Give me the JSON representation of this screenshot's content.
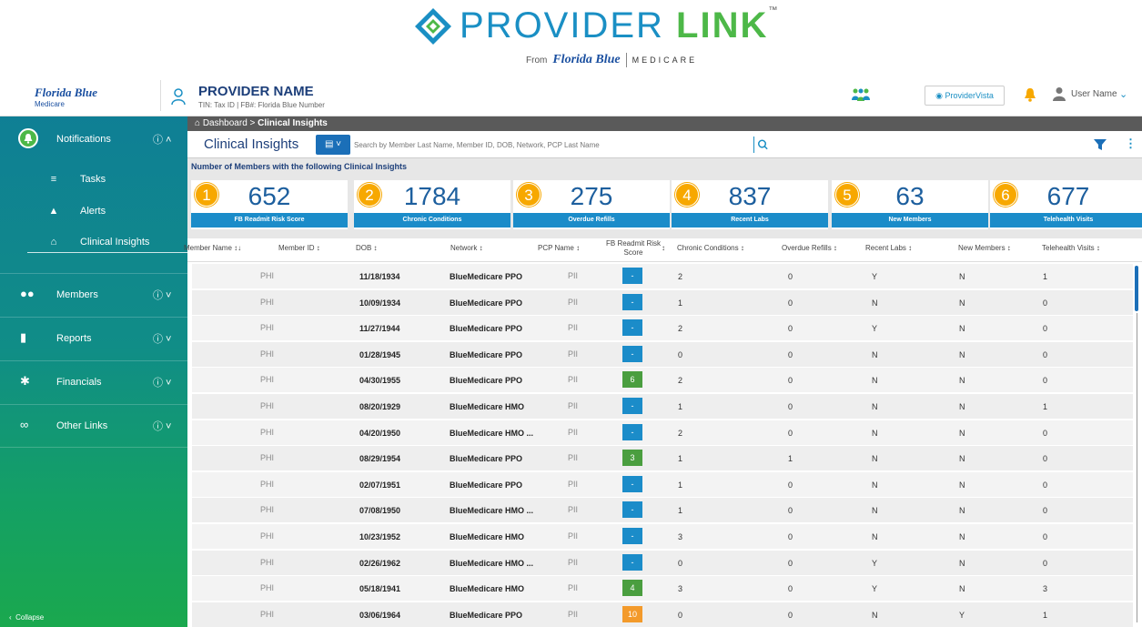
{
  "brand": {
    "title_part1": "PROVIDER ",
    "title_part2": "LINK",
    "trademark": "™",
    "sub_from": "From",
    "sub_company": "Florida Blue",
    "sub_medicare": "MEDICARE"
  },
  "header": {
    "company": "Florida Blue",
    "company_sub": "Medicare",
    "provider_name": "PROVIDER NAME",
    "tin_line": "TIN: Tax ID  |  FB#: Florida Blue Number",
    "provider_vista": "ProviderVista",
    "user_name": "User Name"
  },
  "sidebar": {
    "notifications": "Notifications",
    "sub_items": [
      "Tasks",
      "Alerts",
      "Clinical Insights"
    ],
    "sections": [
      "Members",
      "Reports",
      "Financials",
      "Other Links"
    ],
    "collapse": "Collapse"
  },
  "breadcrumb": {
    "home": "Dashboard",
    "sep": " > ",
    "current": "Clinical Insights"
  },
  "toolbar": {
    "title": "Clinical Insights",
    "search_placeholder": "Search by Member Last Name, Member ID, DOB, Network, PCP Last Name"
  },
  "cards": {
    "title": "Number of Members with the following Clinical Insights",
    "items": [
      {
        "badge": "1",
        "value": "652",
        "label": "FB Readmit Risk Score"
      },
      {
        "badge": "2",
        "value": "1784",
        "label": "Chronic Conditions"
      },
      {
        "badge": "3",
        "value": "275",
        "label": "Overdue Refills"
      },
      {
        "badge": "4",
        "value": "837",
        "label": "Recent Labs"
      },
      {
        "badge": "5",
        "value": "63",
        "label": "New Members"
      },
      {
        "badge": "6",
        "value": "677",
        "label": "Telehealth Visits"
      }
    ]
  },
  "table": {
    "headers": {
      "member_name": "Member Name ↕↓",
      "member_id": "Member ID ↕",
      "dob": "DOB ↕",
      "network": "Network ↕",
      "pcp": "PCP Name ↕",
      "risk": "FB Readmit Risk Score",
      "risk_sort": "↕",
      "chronic": "Chronic Conditions ↕",
      "refills": "Overdue Refills ↕",
      "labs": "Recent Labs ↕",
      "new": "New Members ↕",
      "tele": "Telehealth Visits ↕"
    },
    "rows": [
      {
        "member": "PHI",
        "dob": "11/18/1934",
        "network": "BlueMedicare PPO",
        "pcp": "PII",
        "score": "-",
        "score_color": "#1b8cc9",
        "chronic": "2",
        "refills": "0",
        "labs": "Y",
        "new": "N",
        "tele": "1"
      },
      {
        "member": "PHI",
        "dob": "10/09/1934",
        "network": "BlueMedicare PPO",
        "pcp": "PII",
        "score": "-",
        "score_color": "#1b8cc9",
        "chronic": "1",
        "refills": "0",
        "labs": "N",
        "new": "N",
        "tele": "0"
      },
      {
        "member": "PHI",
        "dob": "11/27/1944",
        "network": "BlueMedicare PPO",
        "pcp": "PII",
        "score": "-",
        "score_color": "#1b8cc9",
        "chronic": "2",
        "refills": "0",
        "labs": "Y",
        "new": "N",
        "tele": "0"
      },
      {
        "member": "PHI",
        "dob": "01/28/1945",
        "network": "BlueMedicare PPO",
        "pcp": "PII",
        "score": "-",
        "score_color": "#1b8cc9",
        "chronic": "0",
        "refills": "0",
        "labs": "N",
        "new": "N",
        "tele": "0"
      },
      {
        "member": "PHI",
        "dob": "04/30/1955",
        "network": "BlueMedicare PPO",
        "pcp": "PII",
        "score": "6",
        "score_color": "#4a9e3f",
        "chronic": "2",
        "refills": "0",
        "labs": "N",
        "new": "N",
        "tele": "0"
      },
      {
        "member": "PHI",
        "dob": "08/20/1929",
        "network": "BlueMedicare HMO",
        "pcp": "PII",
        "score": "-",
        "score_color": "#1b8cc9",
        "chronic": "1",
        "refills": "0",
        "labs": "N",
        "new": "N",
        "tele": "1"
      },
      {
        "member": "PHI",
        "dob": "04/20/1950",
        "network": "BlueMedicare HMO ...",
        "pcp": "PII",
        "score": "-",
        "score_color": "#1b8cc9",
        "chronic": "2",
        "refills": "0",
        "labs": "N",
        "new": "N",
        "tele": "0"
      },
      {
        "member": "PHI",
        "dob": "08/29/1954",
        "network": "BlueMedicare PPO",
        "pcp": "PII",
        "score": "3",
        "score_color": "#4a9e3f",
        "chronic": "1",
        "refills": "1",
        "labs": "N",
        "new": "N",
        "tele": "0"
      },
      {
        "member": "PHI",
        "dob": "02/07/1951",
        "network": "BlueMedicare PPO",
        "pcp": "PII",
        "score": "-",
        "score_color": "#1b8cc9",
        "chronic": "1",
        "refills": "0",
        "labs": "N",
        "new": "N",
        "tele": "0"
      },
      {
        "member": "PHI",
        "dob": "07/08/1950",
        "network": "BlueMedicare HMO ...",
        "pcp": "PII",
        "score": "-",
        "score_color": "#1b8cc9",
        "chronic": "1",
        "refills": "0",
        "labs": "N",
        "new": "N",
        "tele": "0"
      },
      {
        "member": "PHI",
        "dob": "10/23/1952",
        "network": "BlueMedicare HMO",
        "pcp": "PII",
        "score": "-",
        "score_color": "#1b8cc9",
        "chronic": "3",
        "refills": "0",
        "labs": "N",
        "new": "N",
        "tele": "0"
      },
      {
        "member": "PHI",
        "dob": "02/26/1962",
        "network": "BlueMedicare HMO ...",
        "pcp": "PII",
        "score": "-",
        "score_color": "#1b8cc9",
        "chronic": "0",
        "refills": "0",
        "labs": "Y",
        "new": "N",
        "tele": "0"
      },
      {
        "member": "PHI",
        "dob": "05/18/1941",
        "network": "BlueMedicare HMO",
        "pcp": "PII",
        "score": "4",
        "score_color": "#4a9e3f",
        "chronic": "3",
        "refills": "0",
        "labs": "Y",
        "new": "N",
        "tele": "3"
      },
      {
        "member": "PHI",
        "dob": "03/06/1964",
        "network": "BlueMedicare PPO",
        "pcp": "PII",
        "score": "10",
        "score_color": "#f39a2b",
        "chronic": "0",
        "refills": "0",
        "labs": "N",
        "new": "Y",
        "tele": "1"
      }
    ]
  },
  "colors": {
    "brand_blue": "#1a8fc4",
    "brand_green": "#4db848",
    "navy": "#1d3f7a",
    "card_bar": "#1b8cc9",
    "badge_orange": "#f7a800"
  }
}
